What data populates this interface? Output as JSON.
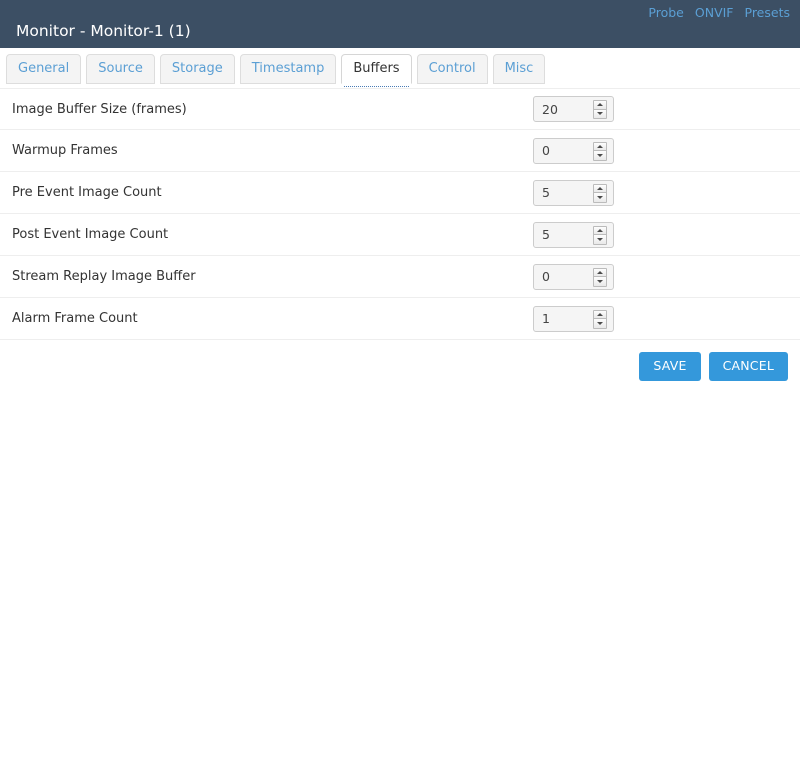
{
  "header": {
    "title": "Monitor - Monitor-1 (1)",
    "links": [
      {
        "label": "Probe",
        "name": "probe"
      },
      {
        "label": "ONVIF",
        "name": "onvif"
      },
      {
        "label": "Presets",
        "name": "presets"
      }
    ],
    "background_color": "#3c4f64",
    "link_color": "#5b9fd4"
  },
  "tabs": [
    {
      "label": "General",
      "active": false
    },
    {
      "label": "Source",
      "active": false
    },
    {
      "label": "Storage",
      "active": false
    },
    {
      "label": "Timestamp",
      "active": false
    },
    {
      "label": "Buffers",
      "active": true
    },
    {
      "label": "Control",
      "active": false
    },
    {
      "label": "Misc",
      "active": false
    }
  ],
  "form": {
    "rows": [
      {
        "label": "Image Buffer Size (frames)",
        "value": "20",
        "name": "image-buffer-size"
      },
      {
        "label": "Warmup Frames",
        "value": "0",
        "name": "warmup-frames"
      },
      {
        "label": "Pre Event Image Count",
        "value": "5",
        "name": "pre-event-image-count"
      },
      {
        "label": "Post Event Image Count",
        "value": "5",
        "name": "post-event-image-count"
      },
      {
        "label": "Stream Replay Image Buffer",
        "value": "0",
        "name": "stream-replay-image-buffer"
      },
      {
        "label": "Alarm Frame Count",
        "value": "1",
        "name": "alarm-frame-count"
      }
    ]
  },
  "actions": {
    "save_label": "SAVE",
    "cancel_label": "CANCEL",
    "button_color": "#3498db"
  }
}
